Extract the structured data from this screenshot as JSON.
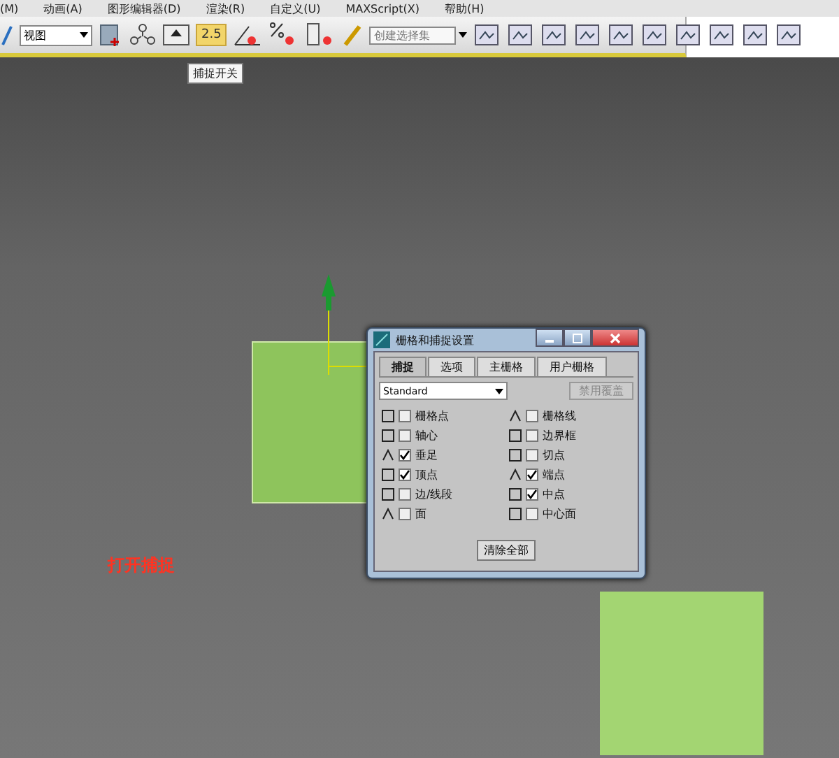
{
  "menu": [
    "(M)",
    "动画(A)",
    "图形编辑器(D)",
    "渲染(R)",
    "自定义(U)",
    "MAXScript(X)",
    "帮助(H)"
  ],
  "toolbar": {
    "view_dropdown": "视图",
    "snap_toggle": {
      "label": "2.5",
      "on": true
    },
    "selection_set": {
      "placeholder": "创建选择集"
    },
    "tooltip": "捕捉开关"
  },
  "viewport": {
    "caption": "打开捕捉"
  },
  "dialog": {
    "title": "栅格和捕捉设置",
    "tabs": [
      {
        "label": "捕捉",
        "selected": true
      },
      {
        "label": "选项",
        "selected": false
      },
      {
        "label": "主栅格",
        "selected": false
      },
      {
        "label": "用户栅格",
        "selected": false
      }
    ],
    "preset": "Standard",
    "override_button": {
      "label": "禁用覆盖",
      "disabled": true
    },
    "snaps": [
      {
        "label": "栅格点",
        "checked": false
      },
      {
        "label": "栅格线",
        "checked": false
      },
      {
        "label": "轴心",
        "checked": false
      },
      {
        "label": "边界框",
        "checked": false
      },
      {
        "label": "垂足",
        "checked": true
      },
      {
        "label": "切点",
        "checked": false
      },
      {
        "label": "顶点",
        "checked": true
      },
      {
        "label": "端点",
        "checked": true
      },
      {
        "label": "边/线段",
        "checked": false
      },
      {
        "label": "中点",
        "checked": true
      },
      {
        "label": "面",
        "checked": false
      },
      {
        "label": "中心面",
        "checked": false
      }
    ],
    "clear_button": "清除全部"
  }
}
